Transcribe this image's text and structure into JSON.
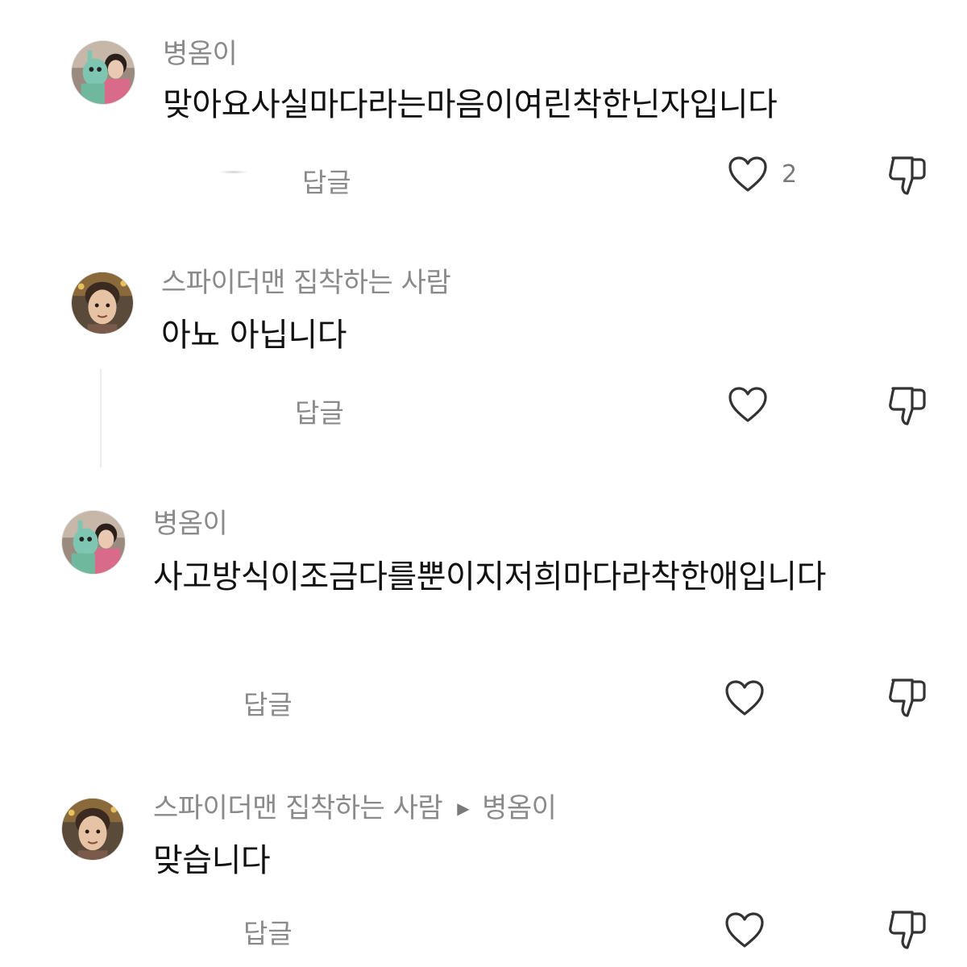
{
  "comments": [
    {
      "username": "병옴이",
      "text": "맞아요사실마다라는마음이여린착한닌자입니다",
      "reply_label": "답글",
      "like_count": "2"
    },
    {
      "username": "스파이더맨 집착하는 사람",
      "text": "아뇨 아닙니다",
      "reply_label": "답글",
      "like_count": ""
    },
    {
      "username": "병옴이",
      "text": "사고방식이조금다를뿐이지저희마다라착한애입니다",
      "reply_label": "답글",
      "like_count": ""
    },
    {
      "username": "스파이더맨 집착하는 사람",
      "reply_to_arrow": "▶",
      "reply_to": "병옴이",
      "text": "맞습니다",
      "reply_label": "답글",
      "like_count": ""
    }
  ],
  "icons": {
    "like": "heart-outline-icon",
    "dislike": "thumbs-down-outline-icon",
    "reply_indicator": "triangle-right-icon"
  },
  "colors": {
    "username": "#8a8a8a",
    "text": "#111111",
    "icon": "#333333"
  }
}
